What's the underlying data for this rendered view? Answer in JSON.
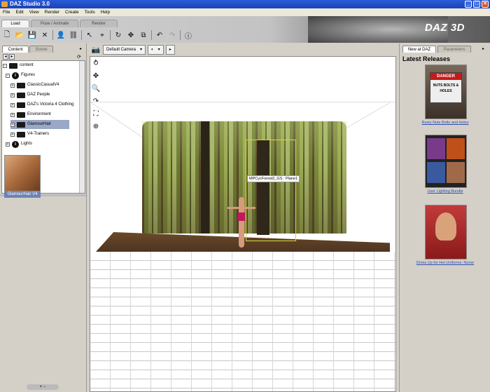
{
  "window": {
    "title": "DAZ Studio 3.0",
    "controls": [
      "_",
      "□",
      "✕"
    ]
  },
  "menu": [
    "File",
    "Edit",
    "View",
    "Render",
    "Create",
    "Tools",
    "Help"
  ],
  "main_tabs": [
    "Load",
    "Pose / Animate",
    "Render"
  ],
  "brand": {
    "logo": "DAZ 3D"
  },
  "left_panel": {
    "tabs": [
      "Content",
      "Scene"
    ],
    "tree": [
      {
        "label": "content",
        "level": 0
      },
      {
        "label": "Figures",
        "level": 1
      },
      {
        "label": "ClassicCasualV4",
        "level": 2
      },
      {
        "label": "DAZ People",
        "level": 2
      },
      {
        "label": "DAZ's Victoria 4 Clothing",
        "level": 2
      },
      {
        "label": "Environment",
        "level": 2
      },
      {
        "label": "GlamourHair",
        "level": 2,
        "selected": true
      },
      {
        "label": "V4-Trainers",
        "level": 2
      },
      {
        "label": "Lights",
        "level": 1
      }
    ],
    "thumbnail_label": "GlamourHair V4"
  },
  "viewport": {
    "camera": "Default Camera",
    "object_label": "MPCycForest2_GS : Plane1"
  },
  "right_panel": {
    "tabs": [
      "New at DAZ",
      "Parameters"
    ],
    "heading": "Latest Releases",
    "products": [
      {
        "title": "Rusty Nuts Bolts and Holes",
        "sign_top": "DANGER",
        "sign_text": "NUTS BOLTS & HOLES"
      },
      {
        "title": "User Lighting Bundle"
      },
      {
        "title": "Dress Up for Hot Uniforms: Nurse"
      }
    ]
  },
  "colors": {
    "titlebar": "#2358d4",
    "selection": "#6e82b3",
    "link": "#2b4fb3"
  }
}
